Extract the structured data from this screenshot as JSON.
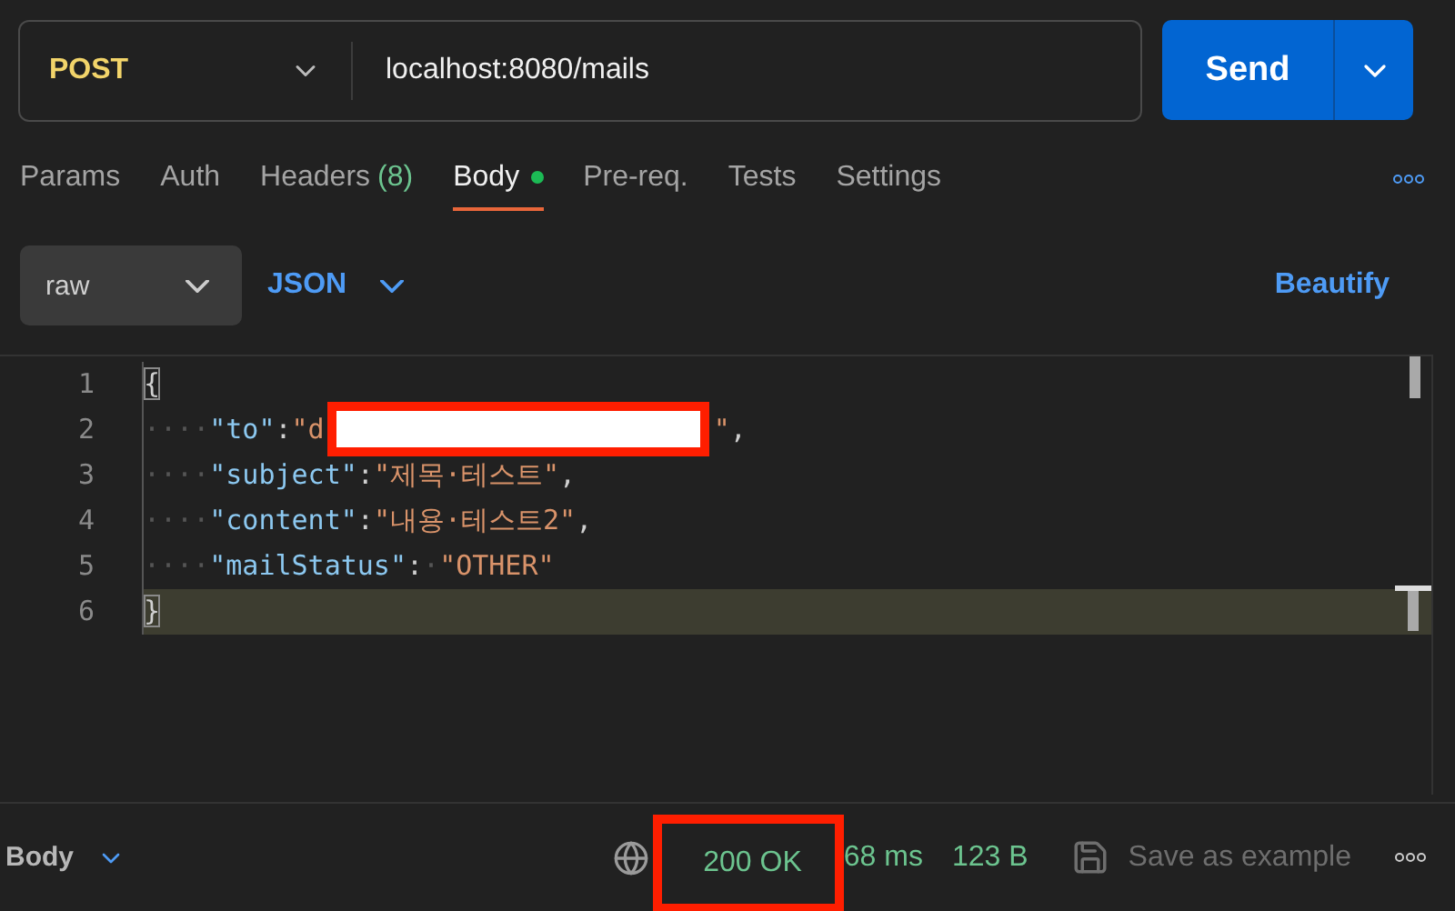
{
  "request": {
    "method": "POST",
    "url": "localhost:8080/mails",
    "send_label": "Send"
  },
  "tabs": [
    {
      "label": "Params",
      "selected": false
    },
    {
      "label": "Auth",
      "selected": false
    },
    {
      "label": "Headers",
      "count": "(8)",
      "selected": false
    },
    {
      "label": "Body",
      "selected": true,
      "has_content": true
    },
    {
      "label": "Pre-req.",
      "selected": false
    },
    {
      "label": "Tests",
      "selected": false
    },
    {
      "label": "Settings",
      "selected": false
    }
  ],
  "body_mode": {
    "mode": "raw",
    "language": "JSON",
    "action": "Beautify"
  },
  "editor": {
    "lines": [
      {
        "number": "1",
        "active": false,
        "tokens": [
          {
            "kind": "brace",
            "text": "{",
            "matched": true
          }
        ]
      },
      {
        "number": "2",
        "active": false,
        "tokens": [
          {
            "kind": "ws",
            "text": "····"
          },
          {
            "kind": "key",
            "text": "\"to\""
          },
          {
            "kind": "punct",
            "text": ":"
          },
          {
            "kind": "string",
            "text": "\"d"
          },
          {
            "kind": "redaction"
          },
          {
            "kind": "string",
            "text": "\""
          },
          {
            "kind": "punct",
            "text": ","
          }
        ]
      },
      {
        "number": "3",
        "active": false,
        "tokens": [
          {
            "kind": "ws",
            "text": "····"
          },
          {
            "kind": "key",
            "text": "\"subject\""
          },
          {
            "kind": "punct",
            "text": ":"
          },
          {
            "kind": "string",
            "text": "\"제목·테스트\""
          },
          {
            "kind": "punct",
            "text": ","
          }
        ]
      },
      {
        "number": "4",
        "active": false,
        "tokens": [
          {
            "kind": "ws",
            "text": "····"
          },
          {
            "kind": "key",
            "text": "\"content\""
          },
          {
            "kind": "punct",
            "text": ":"
          },
          {
            "kind": "string",
            "text": "\"내용·테스트2\""
          },
          {
            "kind": "punct",
            "text": ","
          }
        ]
      },
      {
        "number": "5",
        "active": false,
        "tokens": [
          {
            "kind": "ws",
            "text": "····"
          },
          {
            "kind": "key",
            "text": "\"mailStatus\""
          },
          {
            "kind": "punct",
            "text": ":"
          },
          {
            "kind": "ws",
            "text": "·"
          },
          {
            "kind": "string",
            "text": "\"OTHER\""
          }
        ]
      },
      {
        "number": "6",
        "active": true,
        "tokens": [
          {
            "kind": "brace",
            "text": "}",
            "matched": true
          }
        ]
      }
    ]
  },
  "response_bar": {
    "label": "Body",
    "status": "200 OK",
    "status_highlighted": true,
    "time": "68 ms",
    "size": "123 B",
    "save_label": "Save as example"
  }
}
